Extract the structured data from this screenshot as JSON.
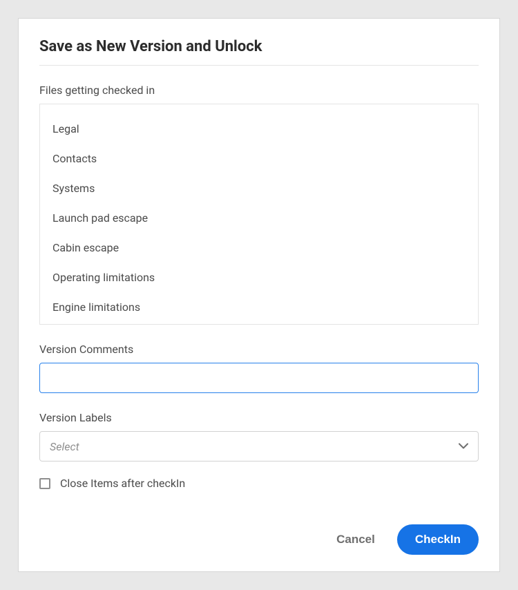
{
  "dialog": {
    "title": "Save as New Version and Unlock"
  },
  "files_section": {
    "label": "Files getting checked in",
    "items": [
      "Legal",
      "Contacts",
      "Systems",
      "Launch pad escape",
      "Cabin escape",
      "Operating limitations",
      "Engine limitations"
    ]
  },
  "version_comments": {
    "label": "Version Comments",
    "value": ""
  },
  "version_labels": {
    "label": "Version Labels",
    "placeholder": "Select"
  },
  "close_items": {
    "label": "Close Items after checkIn",
    "checked": false
  },
  "buttons": {
    "cancel": "Cancel",
    "checkin": "CheckIn"
  }
}
